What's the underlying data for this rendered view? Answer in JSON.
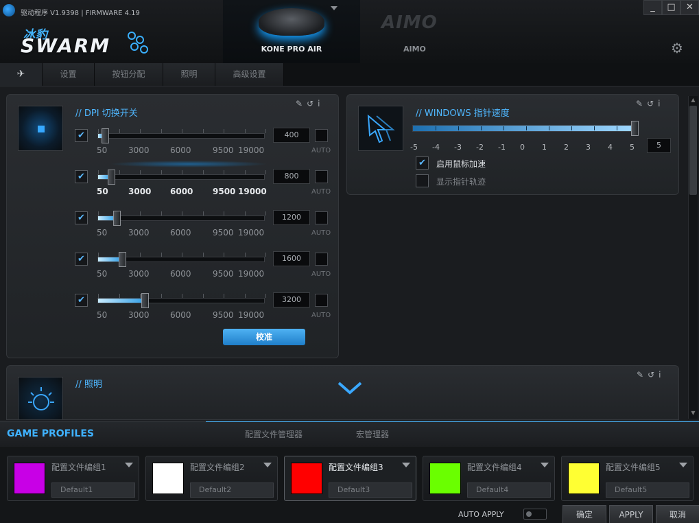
{
  "window": {
    "title": "驱动程序 V1.9398 | FIRMWARE 4.19",
    "controls": [
      "_",
      "□",
      "✕"
    ]
  },
  "brand": {
    "top": "冰豹",
    "name": "SWARM"
  },
  "devices": [
    {
      "name": "KONE PRO AIR",
      "active": true
    },
    {
      "name": "AIMO",
      "logo": "AIMO",
      "active": false
    }
  ],
  "icons": {
    "pin": "pin-icon",
    "reset": "reset-icon",
    "info": "info-icon",
    "settings": "gear-icon",
    "check": "checkmark-icon",
    "expand": "chevron-down-icon"
  },
  "tabs": [
    {
      "label": "",
      "icon": "pin-icon"
    },
    {
      "label": "设置"
    },
    {
      "label": "按钮分配"
    },
    {
      "label": "照明"
    },
    {
      "label": "高级设置"
    }
  ],
  "dpi_panel": {
    "title": "// DPI 切换开关",
    "scale_labels": [
      "50",
      "3000",
      "6000",
      "9500",
      "19000"
    ],
    "auto_label": "AUTO",
    "range": [
      50,
      19000
    ],
    "rows": [
      {
        "enabled": true,
        "value": "400",
        "level": 400,
        "auto": false
      },
      {
        "enabled": true,
        "value": "800",
        "level": 800,
        "auto": false
      },
      {
        "enabled": true,
        "value": "1200",
        "level": 1200,
        "auto": false
      },
      {
        "enabled": true,
        "value": "1600",
        "level": 1600,
        "auto": false
      },
      {
        "enabled": true,
        "value": "3200",
        "level": 3200,
        "auto": false
      }
    ],
    "calibrate_label": "校准"
  },
  "pointer_panel": {
    "title": "// WINDOWS 指针速度",
    "scale": [
      "-5",
      "-4",
      "-3",
      "-2",
      "-1",
      "0",
      "1",
      "2",
      "3",
      "4",
      "5"
    ],
    "value": "5",
    "level": 5,
    "options": [
      {
        "label": "启用鼠标加速",
        "checked": true
      },
      {
        "label": "显示指针轨迹",
        "checked": false
      }
    ]
  },
  "lighting_panel": {
    "title": "// 照明"
  },
  "profiles": {
    "title": "GAME PROFILES",
    "tabs": [
      "配置文件管理器",
      "宏管理器"
    ],
    "cards": [
      {
        "name": "配置文件编组1",
        "default": "Default1",
        "color": "#c800e6",
        "active": false
      },
      {
        "name": "配置文件编组2",
        "default": "Default2",
        "color": "#ffffff",
        "active": false
      },
      {
        "name": "配置文件编组3",
        "default": "Default3",
        "color": "#ff0000",
        "active": true
      },
      {
        "name": "配置文件编组4",
        "default": "Default4",
        "color": "#6aff00",
        "active": false
      },
      {
        "name": "配置文件编组5",
        "default": "Default5",
        "color": "#ffff33",
        "active": false
      }
    ],
    "auto_apply_label": "AUTO APPLY",
    "buttons": [
      "确定",
      "APPLY",
      "取消"
    ]
  }
}
